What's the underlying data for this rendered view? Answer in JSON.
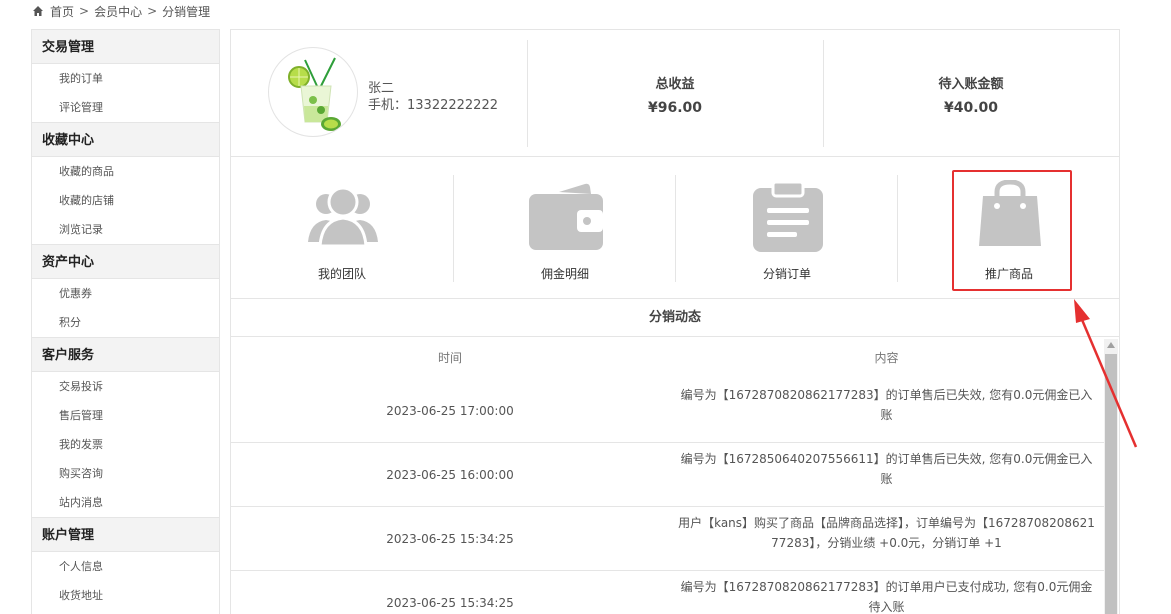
{
  "breadcrumb": {
    "items": [
      "首页",
      "会员中心",
      "分销管理"
    ],
    "separator": ">"
  },
  "sidebar": {
    "groups": [
      {
        "title": "交易管理",
        "items": [
          "我的订单",
          "评论管理"
        ]
      },
      {
        "title": "收藏中心",
        "items": [
          "收藏的商品",
          "收藏的店铺",
          "浏览记录"
        ]
      },
      {
        "title": "资产中心",
        "items": [
          "优惠券",
          "积分"
        ]
      },
      {
        "title": "客户服务",
        "items": [
          "交易投诉",
          "售后管理",
          "我的发票",
          "购买咨询",
          "站内消息"
        ]
      },
      {
        "title": "账户管理",
        "items": [
          "个人信息",
          "收货地址"
        ]
      }
    ]
  },
  "profile": {
    "name": "张二",
    "phone_label": "手机：",
    "phone": "13322222222"
  },
  "stats": [
    {
      "title": "总收益",
      "value": "¥96.00"
    },
    {
      "title": "待入账金额",
      "value": "¥40.00"
    }
  ],
  "quick_links": [
    {
      "label": "我的团队",
      "icon": "team-icon"
    },
    {
      "label": "佣金明细",
      "icon": "wallet-icon"
    },
    {
      "label": "分销订单",
      "icon": "clipboard-icon"
    },
    {
      "label": "推广商品",
      "icon": "shopping-bag-icon"
    }
  ],
  "activity": {
    "title": "分销动态",
    "columns": [
      "时间",
      "内容"
    ],
    "rows": [
      {
        "time": "2023-06-25 17:00:00",
        "content": "编号为【1672870820862177283】的订单售后已失效, 您有0.0元佣金已入账"
      },
      {
        "time": "2023-06-25 16:00:00",
        "content": "编号为【1672850640207556611】的订单售后已失效, 您有0.0元佣金已入账"
      },
      {
        "time": "2023-06-25 15:34:25",
        "content": "用户【kans】购买了商品【品牌商品选择】，订单编号为【1672870820862177283】，分销业绩 +0.0元，分销订单 +1"
      },
      {
        "time": "2023-06-25 15:34:25",
        "content": "编号为【1672870820862177283】的订单用户已支付成功, 您有0.0元佣金待入账"
      }
    ]
  },
  "colors": {
    "highlight": "#e53030",
    "icon_gray": "#c4c4c4",
    "border": "#e5e5e5"
  }
}
